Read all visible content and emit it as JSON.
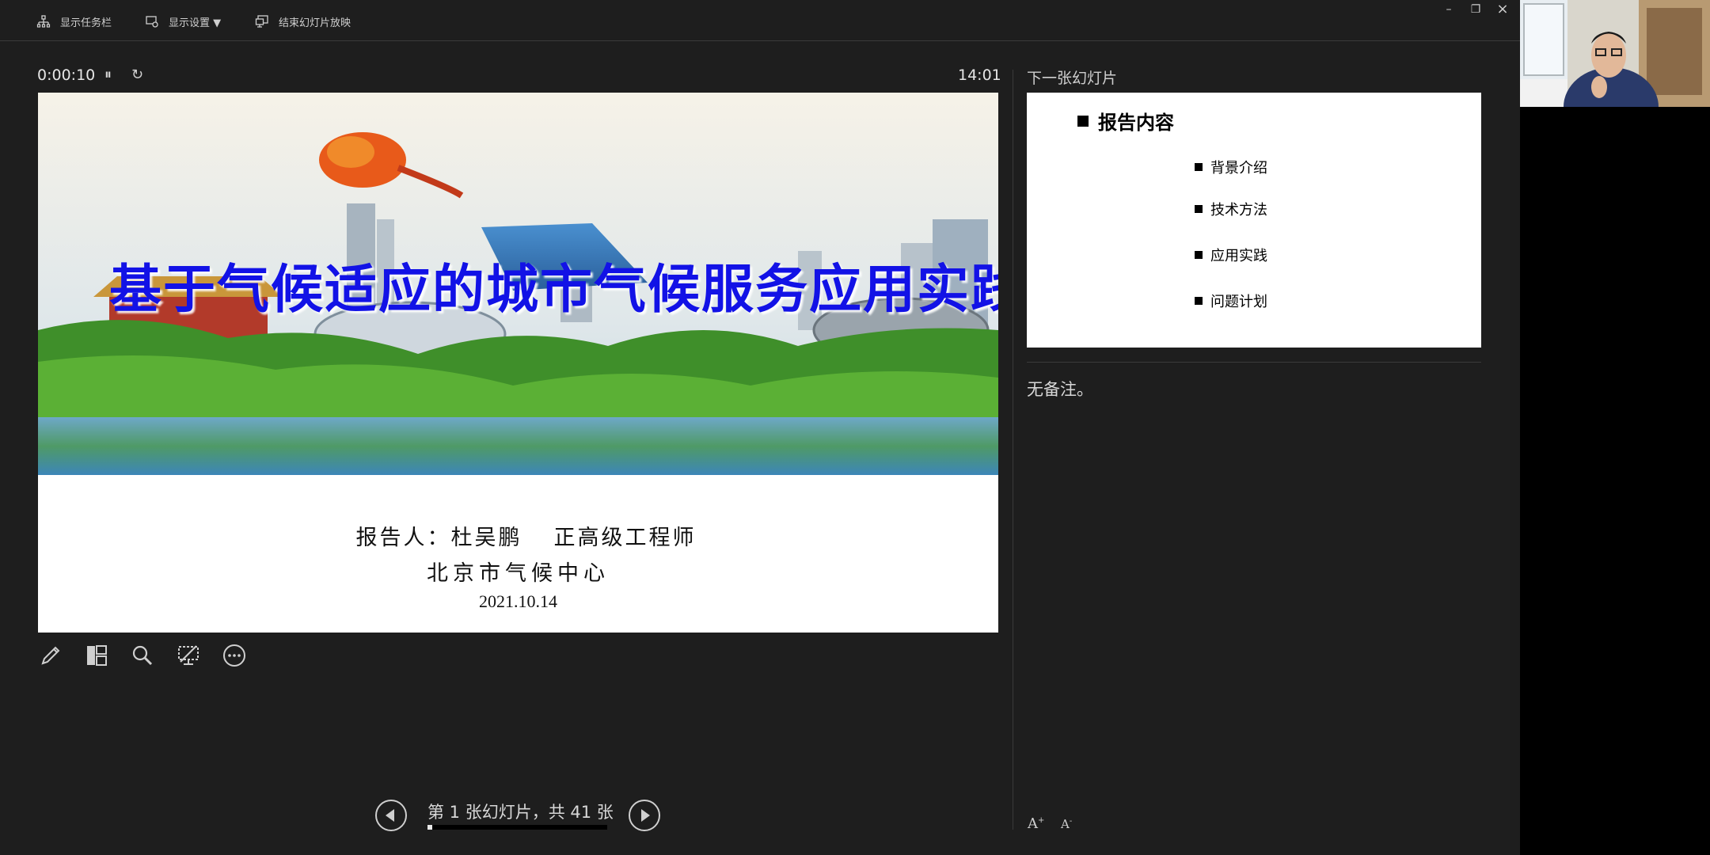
{
  "toolbar": {
    "show_taskbar": "显示任务栏",
    "display_settings": "显示设置 ▼",
    "end_show": "结束幻灯片放映"
  },
  "window": {
    "minimize": "–",
    "restore": "❐",
    "close": "×"
  },
  "timer": {
    "elapsed": "0:00:10",
    "pause_icon": "⏸",
    "reset_icon": "↻",
    "clock": "14:01"
  },
  "current_slide": {
    "title": "基于气候适应的城市气候服务应用实践",
    "reporter_label": "报告人：杜吴鹏",
    "reporter_title": "正高级工程师",
    "organization": "北京市气候中心",
    "date": "2021.10.14"
  },
  "tools": [
    "pen-icon",
    "layout-icon",
    "zoom-icon",
    "screen-icon",
    "more-icon"
  ],
  "navigation": {
    "counter": "第 1 张幻灯片，共 41 张",
    "progress": 0.0244
  },
  "next_slide": {
    "label": "下一张幻灯片",
    "heading": "报告内容",
    "items": [
      "背景介绍",
      "技术方法",
      "应用实践",
      "问题计划"
    ]
  },
  "notes": {
    "text": "无备注。"
  },
  "font_controls": {
    "increase": "A",
    "decrease": "A"
  },
  "colors": {
    "title_blue": "#1212e6",
    "background": "#1e1e1e"
  }
}
